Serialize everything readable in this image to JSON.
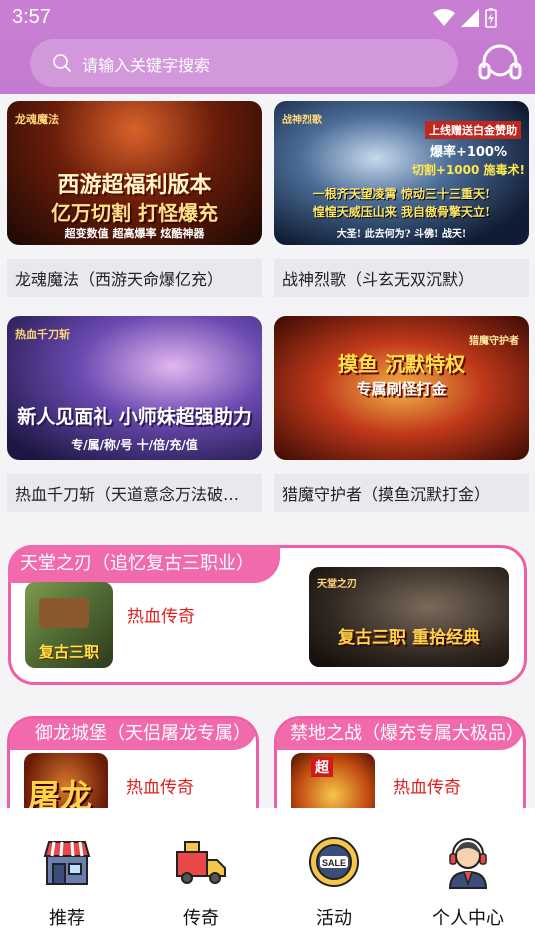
{
  "status_bar": {
    "time": "3:57"
  },
  "search": {
    "placeholder": "请输入关键字搜索"
  },
  "games": [
    {
      "name": "龙魂魔法（西游天命爆亿充）",
      "banner_lines": [
        "西游超福利版本",
        "亿万切割 打怪爆充",
        "超变数值 超高爆率 炫酷神器"
      ],
      "tag": "龙魂魔法"
    },
    {
      "name": "战神烈歌（斗玄无双沉默）",
      "banner_lines": [
        "上线赠送白金赞助",
        "爆率+100%",
        "切割+1000 施毒术!",
        "一根齐天望凌霄 惊动三十三重天!",
        "惶惶天威压山来 我自傲骨擎天立!",
        "大圣! 此去何为? 斗佛! 战天!"
      ],
      "tag": "战神烈歌"
    },
    {
      "name": "热血千刀斩（天道意念万法破…",
      "banner_lines": [
        "新人见面礼 小师妹超强助力",
        "专/属/称/号 十/倍/充/值"
      ],
      "tag": "热血千刀斩"
    },
    {
      "name": "猎魔守护者（摸鱼沉默打金）",
      "banner_lines": [
        "摸鱼 沉默特权",
        "专属刷怪打金"
      ],
      "tag": "猎魔守护者"
    }
  ],
  "featured": {
    "title": "天堂之刃（追忆复古三职业）",
    "category": "热血传奇",
    "thumb_label": "复古三职",
    "banner_text": "复古三职 重拾经典",
    "banner_logo": "天堂之刃"
  },
  "mini_cards": [
    {
      "title": "御龙城堡（天侣屠龙专属）",
      "category": "热血传奇",
      "thumb_text": "屠龙"
    },
    {
      "title": "禁地之战（爆充专属大极品）",
      "category": "热血传奇",
      "thumb_text": "超"
    }
  ],
  "tabs": [
    {
      "label": "推荐",
      "icon": "store-icon"
    },
    {
      "label": "传奇",
      "icon": "delivery-truck-icon"
    },
    {
      "label": "活动",
      "icon": "sale-badge-icon"
    },
    {
      "label": "个人中心",
      "icon": "support-agent-icon"
    }
  ],
  "colors": {
    "header": "#c47ad0",
    "accent_pink": "#f06aac",
    "category_red": "#e02020"
  }
}
